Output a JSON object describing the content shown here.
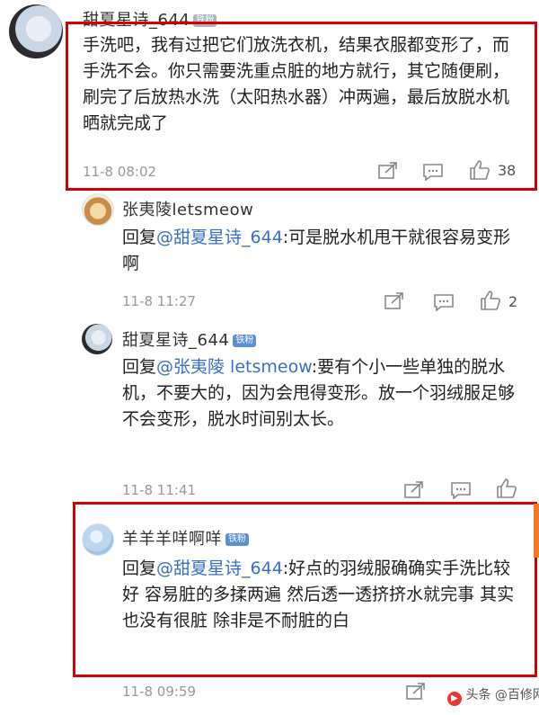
{
  "comments": [
    {
      "user": "甜夏星诗_644",
      "badge": "铁粉",
      "text": "手洗吧，我有过把它们放洗衣机，结果衣服都变形了，而手洗不会。你只需要洗重点脏的地方就行，其它随便刷，刷完了后放热水洗（太阳热水器）冲两遍，最后放脱水机晒就完成了",
      "time": "11-8 08:02",
      "likes": "38"
    },
    {
      "user": "张夷陵letsmeow",
      "reply_prefix": "回复",
      "mention": "@甜夏星诗_644",
      "text": ":可是脱水机甩干就很容易变形啊",
      "time": "11-8 11:27",
      "likes": "2"
    },
    {
      "user": "甜夏星诗_644",
      "badge": "铁粉",
      "reply_prefix": "回复",
      "mention": "@张夷陵 letsmeow",
      "text": ":要有个小一些单独的脱水机，不要大的，因为会甩得变形。放一个羽绒服足够不会变形，脱水时间别太长。",
      "time": "11-8 11:41"
    },
    {
      "user": "羊羊羊咩啊咩",
      "badge": "铁粉",
      "reply_prefix": "回复",
      "mention": "@甜夏星诗_644",
      "text": ":好点的羽绒服确确实手洗比较好 容易脏的多揉两遍 然后透一透挤挤水就完事 其实也没有很脏 除非是不耐脏的白",
      "time": "11-8 09:59"
    }
  ],
  "watermark": "头条 @百修网",
  "colors": {
    "highlight_border": "#d40000",
    "mention": "#3a6fc4"
  }
}
